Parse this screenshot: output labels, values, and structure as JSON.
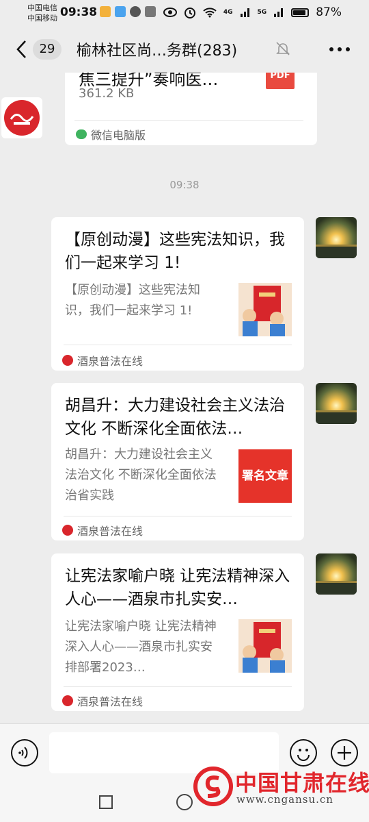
{
  "status_bar": {
    "carrier1": "中国电信",
    "carrier2": "中国移动",
    "time": "09:38",
    "net1": "4G",
    "net2": "5G",
    "battery": "87%"
  },
  "header": {
    "back_count": "29",
    "title": "榆林社区尚…务群(283)"
  },
  "messages": {
    "file": {
      "name": "焦三提升”奏响医…",
      "size": "361.2 KB",
      "type": "PDF",
      "source": "微信电脑版"
    },
    "timestamp": "09:38",
    "articles": [
      {
        "title": "【原创动漫】这些宪法知识，我们一起来学习 1!",
        "desc": "【原创动漫】这些宪法知识，我们一起来学习 1!",
        "source": "酒泉普法在线",
        "thumb": "constitution-cartoon"
      },
      {
        "title": "胡昌升：大力建设社会主义法治文化 不断深化全面依法…",
        "desc": "胡昌升：大力建设社会主义法治文化 不断深化全面依法治省实践",
        "source": "酒泉普法在线",
        "thumb_text": "署名文章"
      },
      {
        "title": "让宪法家喻户晓  让宪法精神深入人心——酒泉市扎实安…",
        "desc": "让宪法家喻户晓  让宪法精神深入人心——酒泉市扎实安排部署2023…",
        "source": "酒泉普法在线",
        "thumb": "constitution-cartoon"
      }
    ]
  },
  "watermark": {
    "text": "中国甘肃在线",
    "url": "www.cngansu.cn"
  },
  "colors": {
    "background": "#ededed",
    "pdf_red": "#e94a3f",
    "watermark_red": "#e1262c",
    "wechat_green": "#3fb35f"
  }
}
